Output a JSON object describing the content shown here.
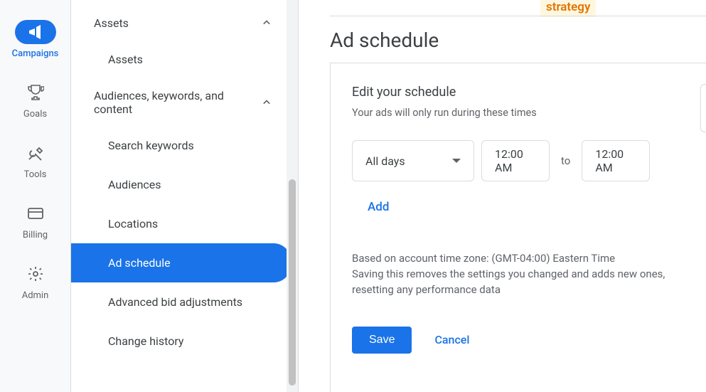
{
  "iconbar": {
    "items": [
      {
        "label": "Campaigns"
      },
      {
        "label": "Goals"
      },
      {
        "label": "Tools"
      },
      {
        "label": "Billing"
      },
      {
        "label": "Admin"
      }
    ]
  },
  "sidebar": {
    "groups": [
      {
        "label": "Assets"
      },
      {
        "label": "Audiences, keywords, and content"
      }
    ],
    "children": [
      {
        "label": "Assets"
      },
      {
        "label": "Search keywords"
      },
      {
        "label": "Audiences"
      },
      {
        "label": "Locations"
      },
      {
        "label": "Ad schedule"
      },
      {
        "label": "Advanced bid adjustments"
      },
      {
        "label": "Change history"
      }
    ]
  },
  "banner": {
    "word": "strategy"
  },
  "page": {
    "title": "Ad schedule"
  },
  "panel": {
    "title": "Edit your schedule",
    "sub": "Your ads will only run during these times",
    "day_select": "All days",
    "from_time": "12:00 AM",
    "to_label": "to",
    "to_time": "12:00 AM",
    "add_label": "Add",
    "note_line1": "Based on account time zone: (GMT-04:00) Eastern Time",
    "note_line2": "Saving this removes the settings you changed and adds new ones, resetting any performance data",
    "save_label": "Save",
    "cancel_label": "Cancel"
  }
}
